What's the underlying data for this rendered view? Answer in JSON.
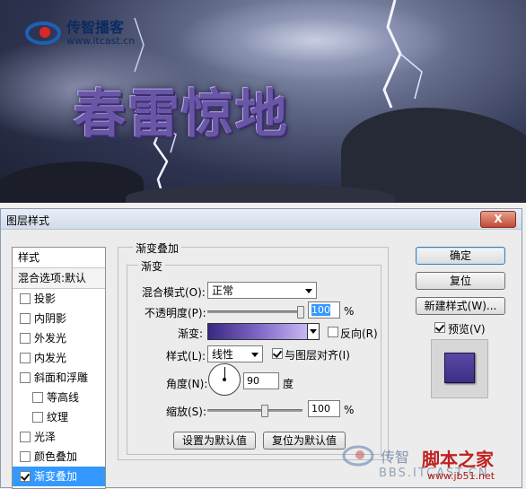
{
  "banner": {
    "logo_name": "传智播客",
    "logo_url": "www.itcast.cn",
    "title": "春雷惊地"
  },
  "dialog": {
    "title": "图层样式",
    "close_label": "X",
    "styles_header": "样式",
    "blend_options": "混合选项:默认",
    "styles": [
      {
        "label": "投影",
        "checked": false,
        "sub": false
      },
      {
        "label": "内阴影",
        "checked": false,
        "sub": false
      },
      {
        "label": "外发光",
        "checked": false,
        "sub": false
      },
      {
        "label": "内发光",
        "checked": false,
        "sub": false
      },
      {
        "label": "斜面和浮雕",
        "checked": false,
        "sub": false
      },
      {
        "label": "等高线",
        "checked": false,
        "sub": true
      },
      {
        "label": "纹理",
        "checked": false,
        "sub": true
      },
      {
        "label": "光泽",
        "checked": false,
        "sub": false
      },
      {
        "label": "颜色叠加",
        "checked": false,
        "sub": false
      },
      {
        "label": "渐变叠加",
        "checked": true,
        "sub": false,
        "selected": true
      }
    ],
    "section_title": "渐变叠加",
    "subsection_title": "渐变",
    "blend_mode_label": "混合模式(O):",
    "blend_mode_value": "正常",
    "opacity_label": "不透明度(P):",
    "opacity_value": "100",
    "opacity_level": 1.0,
    "percent": "%",
    "gradient_label": "渐变:",
    "reverse_label": "反向(R)",
    "style_label": "样式(L):",
    "style_value": "线性",
    "align_label": "与图层对齐(I)",
    "angle_label": "角度(N):",
    "angle_value": "90",
    "angle_unit": "度",
    "scale_label": "缩放(S):",
    "scale_value": "100",
    "scale_level": 1.0,
    "reset_default_button": "设置为默认值",
    "restore_default_button": "复位为默认值",
    "ok_button": "确定",
    "reset_button": "复位",
    "new_style_button": "新建样式(W)...",
    "preview_label": "预览(V)",
    "gradient_colors": [
      "#3a2880",
      "#7d66c6",
      "#c7b8f2"
    ]
  },
  "watermark": {
    "name": "传智",
    "url": "BBS.ITCAST.CN",
    "site_name": "脚本之家",
    "site_url": "www.jb51.net"
  }
}
